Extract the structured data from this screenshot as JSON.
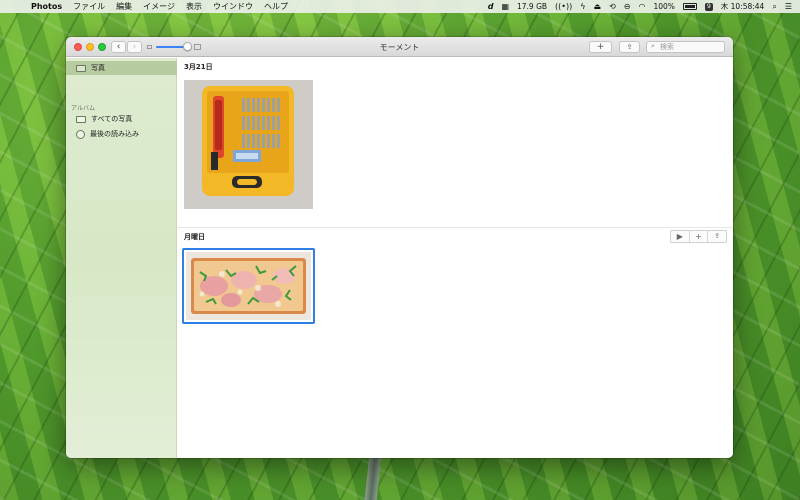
{
  "menubar": {
    "apple": "",
    "app_name": "Photos",
    "items": [
      "ファイル",
      "編集",
      "イメージ",
      "表示",
      "ウインドウ",
      "ヘルプ"
    ],
    "status": {
      "d_icon": "d",
      "storage": "17.9 GB",
      "battery_percent": "100%",
      "date_badge": "9",
      "clock": "木 10:58:44"
    }
  },
  "window": {
    "title": "モーメント",
    "nav": {
      "back": "‹",
      "forward": "›"
    },
    "toolbar": {
      "add": "+",
      "share": "⇪"
    },
    "search": {
      "placeholder": "検索"
    }
  },
  "sidebar": {
    "selected": "写真",
    "section_header": "アルバム",
    "albums": [
      "すべての写真",
      "最後の読み込み"
    ]
  },
  "main": {
    "sections": [
      {
        "title": "3月21日"
      },
      {
        "title": "月曜日"
      }
    ],
    "section_actions": {
      "play": "▶",
      "add": "+",
      "share": "⇪"
    }
  },
  "colors": {
    "selection_blue": "#2f7fe6",
    "sidebar_selected": "#b6cba0",
    "close": "#fd5f57",
    "minimize": "#febc2e",
    "maximize": "#28c840"
  }
}
